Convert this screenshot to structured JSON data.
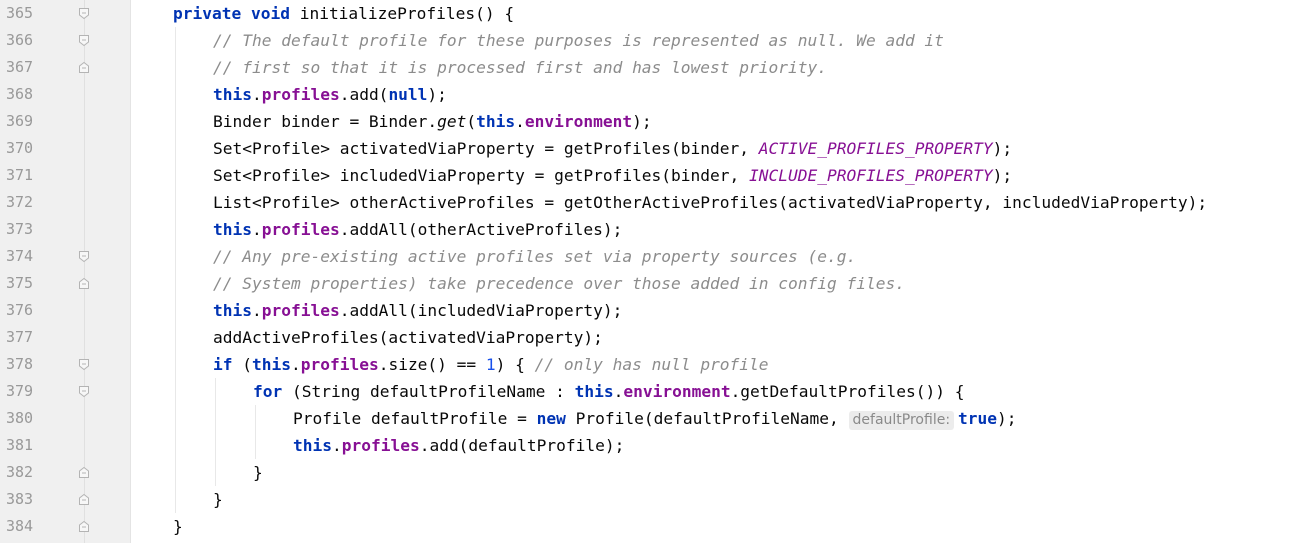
{
  "editor": {
    "lines": [
      {
        "num": "365",
        "fold": "start",
        "indent": 0,
        "tokens": [
          {
            "t": "private void ",
            "c": "kw"
          },
          {
            "t": "initializeProfiles() {",
            "c": ""
          }
        ]
      },
      {
        "num": "366",
        "fold": "start",
        "indent": 1,
        "tokens": [
          {
            "t": "// The default profile for these purposes is represented as null. We add it",
            "c": "cmt"
          }
        ]
      },
      {
        "num": "367",
        "fold": "end",
        "indent": 1,
        "tokens": [
          {
            "t": "// first so that it is processed first and has lowest priority.",
            "c": "cmt"
          }
        ]
      },
      {
        "num": "368",
        "fold": "",
        "indent": 1,
        "tokens": [
          {
            "t": "this",
            "c": "kw"
          },
          {
            "t": ".",
            "c": ""
          },
          {
            "t": "profiles",
            "c": "fld"
          },
          {
            "t": ".add(",
            "c": ""
          },
          {
            "t": "null",
            "c": "kw"
          },
          {
            "t": ");",
            "c": ""
          }
        ]
      },
      {
        "num": "369",
        "fold": "",
        "indent": 1,
        "tokens": [
          {
            "t": "Binder binder = Binder.",
            "c": ""
          },
          {
            "t": "get",
            "c": "static"
          },
          {
            "t": "(",
            "c": ""
          },
          {
            "t": "this",
            "c": "kw"
          },
          {
            "t": ".",
            "c": ""
          },
          {
            "t": "environment",
            "c": "fld"
          },
          {
            "t": ");",
            "c": ""
          }
        ]
      },
      {
        "num": "370",
        "fold": "",
        "indent": 1,
        "tokens": [
          {
            "t": "Set<Profile> activatedViaProperty = getProfiles(binder, ",
            "c": ""
          },
          {
            "t": "ACTIVE_PROFILES_PROPERTY",
            "c": "const"
          },
          {
            "t": ");",
            "c": ""
          }
        ]
      },
      {
        "num": "371",
        "fold": "",
        "indent": 1,
        "tokens": [
          {
            "t": "Set<Profile> includedViaProperty = getProfiles(binder, ",
            "c": ""
          },
          {
            "t": "INCLUDE_PROFILES_PROPERTY",
            "c": "const"
          },
          {
            "t": ");",
            "c": ""
          }
        ]
      },
      {
        "num": "372",
        "fold": "",
        "indent": 1,
        "tokens": [
          {
            "t": "List<Profile> otherActiveProfiles = getOtherActiveProfiles(activatedViaProperty, includedViaProperty);",
            "c": ""
          }
        ]
      },
      {
        "num": "373",
        "fold": "",
        "indent": 1,
        "tokens": [
          {
            "t": "this",
            "c": "kw"
          },
          {
            "t": ".",
            "c": ""
          },
          {
            "t": "profiles",
            "c": "fld"
          },
          {
            "t": ".addAll(otherActiveProfiles);",
            "c": ""
          }
        ]
      },
      {
        "num": "374",
        "fold": "start",
        "indent": 1,
        "tokens": [
          {
            "t": "// Any pre-existing active profiles set via property sources (e.g.",
            "c": "cmt"
          }
        ]
      },
      {
        "num": "375",
        "fold": "end",
        "indent": 1,
        "tokens": [
          {
            "t": "// System properties) take precedence over those added in config files.",
            "c": "cmt"
          }
        ]
      },
      {
        "num": "376",
        "fold": "",
        "indent": 1,
        "tokens": [
          {
            "t": "this",
            "c": "kw"
          },
          {
            "t": ".",
            "c": ""
          },
          {
            "t": "profiles",
            "c": "fld"
          },
          {
            "t": ".addAll(includedViaProperty);",
            "c": ""
          }
        ]
      },
      {
        "num": "377",
        "fold": "",
        "indent": 1,
        "tokens": [
          {
            "t": "addActiveProfiles(activatedViaProperty);",
            "c": ""
          }
        ]
      },
      {
        "num": "378",
        "fold": "start",
        "indent": 1,
        "tokens": [
          {
            "t": "if ",
            "c": "kw"
          },
          {
            "t": "(",
            "c": ""
          },
          {
            "t": "this",
            "c": "kw"
          },
          {
            "t": ".",
            "c": ""
          },
          {
            "t": "profiles",
            "c": "fld"
          },
          {
            "t": ".size() == ",
            "c": ""
          },
          {
            "t": "1",
            "c": "num"
          },
          {
            "t": ") { ",
            "c": ""
          },
          {
            "t": "// only has null profile",
            "c": "cmt"
          }
        ]
      },
      {
        "num": "379",
        "fold": "start",
        "indent": 2,
        "tokens": [
          {
            "t": "for ",
            "c": "kw"
          },
          {
            "t": "(String defaultProfileName : ",
            "c": ""
          },
          {
            "t": "this",
            "c": "kw"
          },
          {
            "t": ".",
            "c": ""
          },
          {
            "t": "environment",
            "c": "fld"
          },
          {
            "t": ".getDefaultProfiles()) {",
            "c": ""
          }
        ]
      },
      {
        "num": "380",
        "fold": "",
        "indent": 3,
        "tokens": [
          {
            "t": "Profile defaultProfile = ",
            "c": ""
          },
          {
            "t": "new ",
            "c": "kw"
          },
          {
            "t": "Profile(defaultProfileName, ",
            "c": ""
          },
          {
            "t": "defaultProfile:",
            "c": "hint"
          },
          {
            "t": "true",
            "c": "kw"
          },
          {
            "t": ");",
            "c": ""
          }
        ]
      },
      {
        "num": "381",
        "fold": "",
        "indent": 3,
        "tokens": [
          {
            "t": "this",
            "c": "kw"
          },
          {
            "t": ".",
            "c": ""
          },
          {
            "t": "profiles",
            "c": "fld"
          },
          {
            "t": ".add(defaultProfile);",
            "c": ""
          }
        ]
      },
      {
        "num": "382",
        "fold": "end",
        "indent": 2,
        "tokens": [
          {
            "t": "}",
            "c": ""
          }
        ]
      },
      {
        "num": "383",
        "fold": "end",
        "indent": 1,
        "tokens": [
          {
            "t": "}",
            "c": ""
          }
        ]
      },
      {
        "num": "384",
        "fold": "end",
        "indent": 0,
        "tokens": [
          {
            "t": "}",
            "c": ""
          }
        ]
      }
    ]
  }
}
